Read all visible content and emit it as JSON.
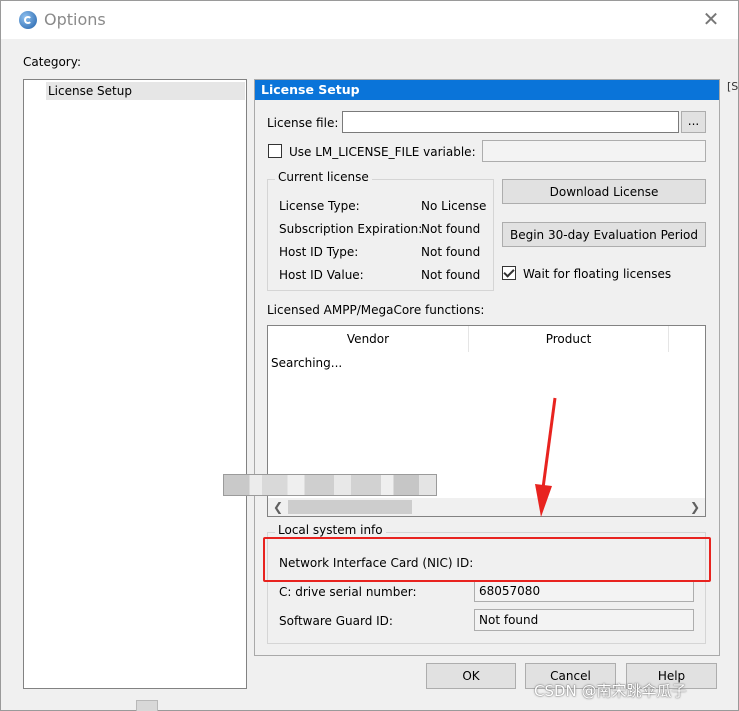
{
  "window": {
    "title": "Options",
    "close_glyph": "✕"
  },
  "category": {
    "label": "Category:",
    "items": [
      {
        "label": "License Setup",
        "selected": true
      }
    ]
  },
  "panel": {
    "header": "License Setup",
    "license_file": {
      "label": "License file:",
      "value": "",
      "browse_label": "..."
    },
    "use_env": {
      "label": "Use LM_LICENSE_FILE variable:",
      "checked": false,
      "value": ""
    },
    "current_license": {
      "title": "Current license",
      "rows": [
        {
          "key": "License Type:",
          "value": "No License"
        },
        {
          "key": "Subscription Expiration:",
          "value": "Not found"
        },
        {
          "key": "Host ID Type:",
          "value": "Not found"
        },
        {
          "key": "Host ID Value:",
          "value": "Not found"
        }
      ]
    },
    "download_button": "Download License",
    "evaluation_button": "Begin 30-day Evaluation Period",
    "wait_floating": {
      "label": "Wait for floating licenses",
      "checked": true
    },
    "functions_label": "Licensed AMPP/MegaCore functions:",
    "table": {
      "columns": [
        "Vendor",
        "Product"
      ],
      "status": "Searching..."
    },
    "local_info": {
      "title": "Local system info",
      "nic_label": "Network Interface Card (NIC) ID:",
      "nic_value": "",
      "drive_label": "C: drive serial number:",
      "drive_value": "68057080",
      "guard_label": "Software Guard ID:",
      "guard_value": "Not found"
    }
  },
  "buttons": {
    "ok": "OK",
    "cancel": "Cancel",
    "help": "Help"
  },
  "watermark": "CSDN @南宋跳伞瓜子",
  "edge_fragment": "[S",
  "colors": {
    "header_blue": "#0a74d9",
    "annotation_red": "#e8231f"
  }
}
